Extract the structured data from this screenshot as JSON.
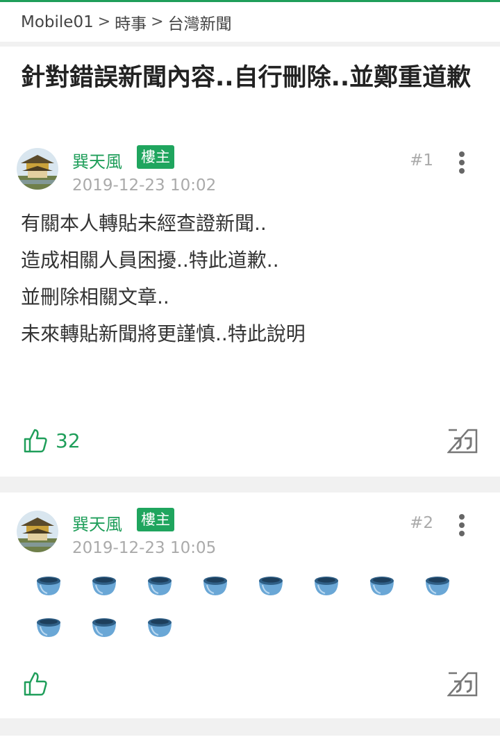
{
  "breadcrumb": {
    "items": [
      "Mobile01",
      "時事",
      "台灣新聞"
    ],
    "separator": ">"
  },
  "thread": {
    "title": "針對錯誤新聞內容..自行刪除..並鄭重道歉"
  },
  "posts": [
    {
      "author": "巽天風",
      "badge": "樓主",
      "date": "2019-12-23 10:02",
      "floor": "#1",
      "lines": [
        "有關本人轉貼未經查證新聞..",
        "造成相關人員困擾..特此道歉..",
        "並刪除相關文章..",
        "未來轉貼新聞將更謹慎..特此說明"
      ],
      "like_count": "32"
    },
    {
      "author": "巽天風",
      "badge": "樓主",
      "date": "2019-12-23 10:05",
      "floor": "#2",
      "emoji_count": 11,
      "emoji_icon": "tea-bowl-icon"
    }
  ],
  "colors": {
    "accent_green": "#1f9e5a",
    "badge_green": "#1fa55e",
    "muted_gray": "#aaaaaa",
    "background": "#f1f1f1"
  }
}
